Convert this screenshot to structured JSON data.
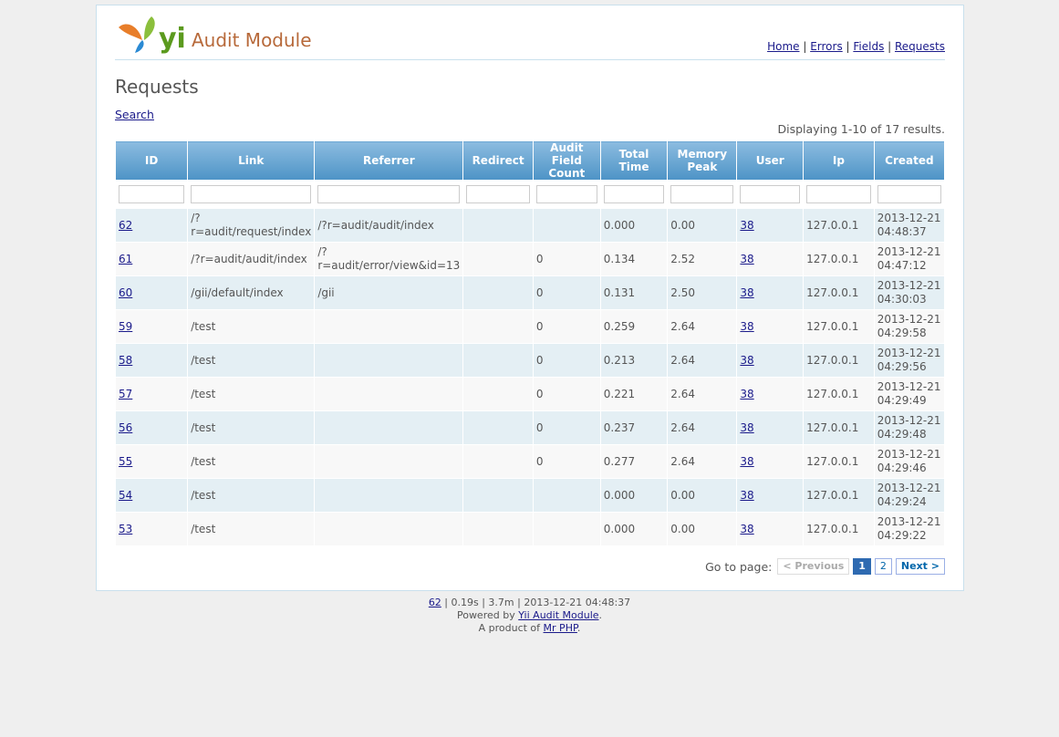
{
  "brand": {
    "logo_text": "yii",
    "title": "Audit Module"
  },
  "nav": [
    {
      "label": "Home"
    },
    {
      "label": "Errors"
    },
    {
      "label": "Fields"
    },
    {
      "label": "Requests"
    }
  ],
  "page_title": "Requests",
  "search_label": "Search",
  "summary": "Displaying 1-10 of 17 results.",
  "columns": [
    "ID",
    "Link",
    "Referrer",
    "Redirect",
    "Audit Field Count",
    "Total Time",
    "Memory Peak",
    "User",
    "Ip",
    "Created"
  ],
  "rows": [
    {
      "id": "62",
      "link": "/?r=audit/request/index",
      "referrer": "/?r=audit/audit/index",
      "redirect": "",
      "afc": "",
      "time": "0.000",
      "mem": "0.00",
      "user": "38",
      "ip": "127.0.0.1",
      "created_date": "2013-12-21",
      "created_time": "04:48:37"
    },
    {
      "id": "61",
      "link": "/?r=audit/audit/index",
      "referrer": "/?r=audit/error/view&id=13",
      "redirect": "",
      "afc": "0",
      "time": "0.134",
      "mem": "2.52",
      "user": "38",
      "ip": "127.0.0.1",
      "created_date": "2013-12-21",
      "created_time": "04:47:12"
    },
    {
      "id": "60",
      "link": "/gii/default/index",
      "referrer": "/gii",
      "redirect": "",
      "afc": "0",
      "time": "0.131",
      "mem": "2.50",
      "user": "38",
      "ip": "127.0.0.1",
      "created_date": "2013-12-21",
      "created_time": "04:30:03"
    },
    {
      "id": "59",
      "link": "/test",
      "referrer": "",
      "redirect": "",
      "afc": "0",
      "time": "0.259",
      "mem": "2.64",
      "user": "38",
      "ip": "127.0.0.1",
      "created_date": "2013-12-21",
      "created_time": "04:29:58"
    },
    {
      "id": "58",
      "link": "/test",
      "referrer": "",
      "redirect": "",
      "afc": "0",
      "time": "0.213",
      "mem": "2.64",
      "user": "38",
      "ip": "127.0.0.1",
      "created_date": "2013-12-21",
      "created_time": "04:29:56"
    },
    {
      "id": "57",
      "link": "/test",
      "referrer": "",
      "redirect": "",
      "afc": "0",
      "time": "0.221",
      "mem": "2.64",
      "user": "38",
      "ip": "127.0.0.1",
      "created_date": "2013-12-21",
      "created_time": "04:29:49"
    },
    {
      "id": "56",
      "link": "/test",
      "referrer": "",
      "redirect": "",
      "afc": "0",
      "time": "0.237",
      "mem": "2.64",
      "user": "38",
      "ip": "127.0.0.1",
      "created_date": "2013-12-21",
      "created_time": "04:29:48"
    },
    {
      "id": "55",
      "link": "/test",
      "referrer": "",
      "redirect": "",
      "afc": "0",
      "time": "0.277",
      "mem": "2.64",
      "user": "38",
      "ip": "127.0.0.1",
      "created_date": "2013-12-21",
      "created_time": "04:29:46"
    },
    {
      "id": "54",
      "link": "/test",
      "referrer": "",
      "redirect": "",
      "afc": "",
      "time": "0.000",
      "mem": "0.00",
      "user": "38",
      "ip": "127.0.0.1",
      "created_date": "2013-12-21",
      "created_time": "04:29:24"
    },
    {
      "id": "53",
      "link": "/test",
      "referrer": "",
      "redirect": "",
      "afc": "",
      "time": "0.000",
      "mem": "0.00",
      "user": "38",
      "ip": "127.0.0.1",
      "created_date": "2013-12-21",
      "created_time": "04:29:22"
    }
  ],
  "pager": {
    "label": "Go to page:",
    "prev": "< Previous",
    "pages": [
      "1",
      "2"
    ],
    "current": "1",
    "next": "Next >"
  },
  "footer": {
    "request_id": "62",
    "stats": " | 0.19s | 3.7m | 2013-12-21 04:48:37",
    "powered_prefix": "Powered by ",
    "powered_link": "Yii Audit Module",
    "powered_suffix": ".",
    "product_prefix": "A product of ",
    "product_link": "Mr PHP",
    "product_suffix": "."
  },
  "colors": {
    "header_top": "#8cbce0",
    "header_bottom": "#4d93c6",
    "row_odd": "#e4eff4",
    "row_even": "#f8f8f8",
    "brand": "#b7693a"
  }
}
